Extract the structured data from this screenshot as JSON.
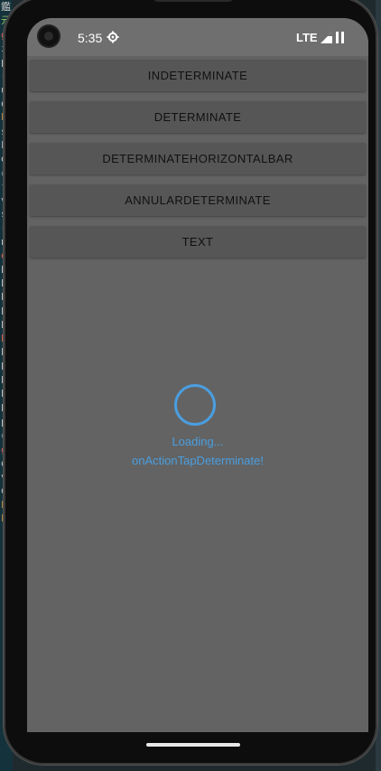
{
  "status_bar": {
    "time": "5:35",
    "network": "LTE",
    "icons": [
      "settings-gear-icon",
      "signal-icon",
      "battery-icon"
    ]
  },
  "buttons": [
    {
      "label": "INDETERMINATE"
    },
    {
      "label": "DETERMINATE"
    },
    {
      "label": "DETERMINATEHORIZONTALBAR"
    },
    {
      "label": "ANNULARDETERMINATE"
    },
    {
      "label": "TEXT"
    }
  ],
  "progress_hud": {
    "indicator": "annular-determinate",
    "progress": 0,
    "label": "Loading...",
    "detail": "onActionTapDeterminate!",
    "color": "#4a9ee0"
  },
  "background_editor_fragments": [
    "鑑",
    "元",
    "g",
    "i",
    "p",
    "ro",
    "u",
    "o",
    "F",
    "s",
    "k",
    "os",
    "e",
    "f",
    "v",
    "s",
    "r",
    "n",
    "ev",
    "Pa",
    "Pa",
    "Pa",
    "Pa",
    "Pa",
    "P",
    "Pa",
    "Pa",
    "Pa",
    "Pa",
    "Pa",
    "p",
    "e",
    "g",
    "o",
    "v",
    "o",
    "ka",
    "kag"
  ]
}
